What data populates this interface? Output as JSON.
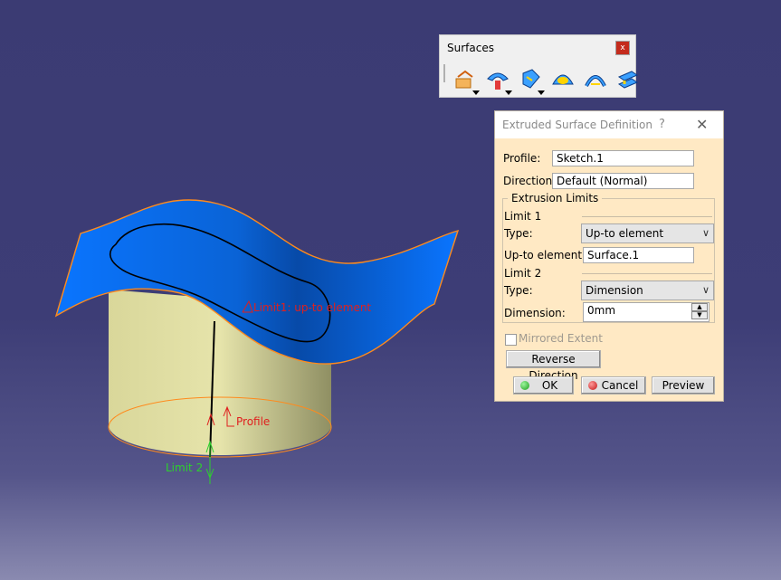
{
  "viewport": {
    "labels": {
      "limit1": "Limit1: up-to element",
      "profile": "Profile",
      "limit2": "Limit 2"
    },
    "colors": {
      "surface": "#0a6ff5",
      "cylinder": "#e2e0a6",
      "highlight": "#ff8a1c",
      "limit1_label": "#e0201e",
      "limit2_label": "#2dd12d"
    }
  },
  "toolbar": {
    "title": "Surfaces",
    "close_label": "x",
    "icons": [
      "extrude-icon",
      "offset-icon",
      "sweep-icon",
      "fill-icon",
      "loft-icon",
      "blend-icon"
    ]
  },
  "dialog": {
    "title": "Extruded Surface Definition",
    "help_label": "?",
    "close_label": "✕",
    "profile_label": "Profile:",
    "profile_value": "Sketch.1",
    "direction_label": "Direction:",
    "direction_value": "Default (Normal)",
    "extrusion_limits_label": "Extrusion Limits",
    "limit1": {
      "title": "Limit 1",
      "type_label": "Type:",
      "type_value": "Up-to element",
      "element_label": "Up-to element:",
      "element_value": "Surface.1"
    },
    "limit2": {
      "title": "Limit 2",
      "type_label": "Type:",
      "type_value": "Dimension",
      "dimension_label": "Dimension:",
      "dimension_value": "0mm"
    },
    "mirrored_label": "Mirrored Extent",
    "mirrored_checked": false,
    "reverse_label": "Reverse Direction",
    "ok_label": "OK",
    "cancel_label": "Cancel",
    "preview_label": "Preview"
  }
}
